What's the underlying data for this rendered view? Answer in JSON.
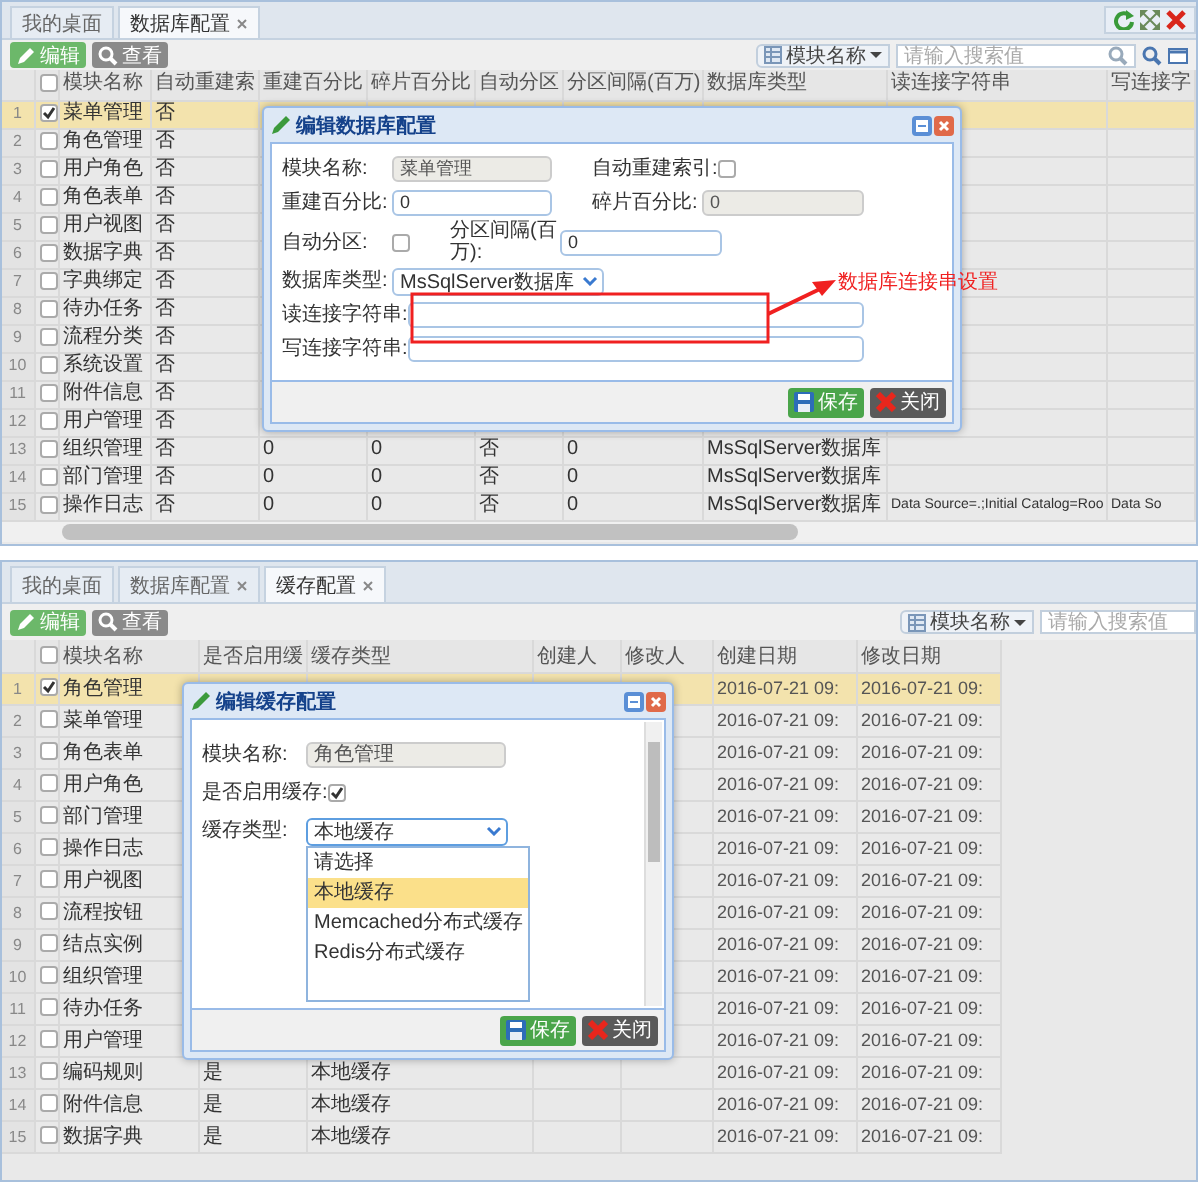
{
  "panels": [
    {
      "tabs": [
        {
          "label": "我的桌面",
          "closable": false,
          "selected": false
        },
        {
          "label": "数据库配置",
          "closable": true,
          "selected": true
        }
      ],
      "toolbar": {
        "buttons": [
          {
            "label": "编辑",
            "kind": "edit"
          },
          {
            "label": "查看",
            "kind": "view"
          }
        ],
        "search": {
          "field": "模块名称",
          "placeholder": "请输入搜索值"
        }
      },
      "table": {
        "all_checked": false,
        "h_scroll": true,
        "columns": [
          "模块名称",
          "自动重建索",
          "重建百分比",
          "碎片百分比",
          "自动分区",
          "分区间隔(百万)",
          "数据库类型",
          "读连接字符串",
          "写连接字"
        ],
        "rows": [
          {
            "no": "1",
            "checked": true,
            "selected": true,
            "cells": [
              "菜单管理",
              "否",
              null,
              null,
              null,
              null,
              null,
              null,
              null
            ]
          },
          {
            "no": "2",
            "checked": false,
            "selected": false,
            "cells": [
              "角色管理",
              "否",
              null,
              null,
              null,
              null,
              null,
              null,
              null
            ]
          },
          {
            "no": "3",
            "checked": false,
            "selected": false,
            "cells": [
              "用户角色",
              "否",
              null,
              null,
              null,
              null,
              null,
              null,
              null
            ]
          },
          {
            "no": "4",
            "checked": false,
            "selected": false,
            "cells": [
              "角色表单",
              "否",
              null,
              null,
              null,
              null,
              null,
              null,
              null
            ]
          },
          {
            "no": "5",
            "checked": false,
            "selected": false,
            "cells": [
              "用户视图",
              "否",
              null,
              null,
              null,
              null,
              null,
              null,
              null
            ]
          },
          {
            "no": "6",
            "checked": false,
            "selected": false,
            "cells": [
              "数据字典",
              "否",
              null,
              null,
              null,
              null,
              null,
              null,
              null
            ]
          },
          {
            "no": "7",
            "checked": false,
            "selected": false,
            "cells": [
              "字典绑定",
              "否",
              null,
              null,
              null,
              null,
              null,
              null,
              null
            ]
          },
          {
            "no": "8",
            "checked": false,
            "selected": false,
            "cells": [
              "待办任务",
              "否",
              null,
              null,
              null,
              null,
              null,
              null,
              null
            ]
          },
          {
            "no": "9",
            "checked": false,
            "selected": false,
            "cells": [
              "流程分类",
              "否",
              null,
              null,
              null,
              null,
              null,
              null,
              null
            ]
          },
          {
            "no": "10",
            "checked": false,
            "selected": false,
            "cells": [
              "系统设置",
              "否",
              null,
              null,
              null,
              null,
              null,
              null,
              null
            ]
          },
          {
            "no": "11",
            "checked": false,
            "selected": false,
            "cells": [
              "附件信息",
              "否",
              null,
              null,
              null,
              null,
              null,
              null,
              null
            ]
          },
          {
            "no": "12",
            "checked": false,
            "selected": false,
            "cells": [
              "用户管理",
              "否",
              null,
              null,
              null,
              null,
              null,
              null,
              null
            ]
          },
          {
            "no": "13",
            "checked": false,
            "selected": false,
            "cells": [
              "组织管理",
              "否",
              "0",
              "0",
              "否",
              "0",
              "MsSqlServer数据库",
              null,
              null
            ]
          },
          {
            "no": "14",
            "checked": false,
            "selected": false,
            "cells": [
              "部门管理",
              "否",
              "0",
              "0",
              "否",
              "0",
              "MsSqlServer数据库",
              null,
              null
            ]
          },
          {
            "no": "15",
            "checked": false,
            "selected": false,
            "cells": [
              "操作日志",
              "否",
              "0",
              "0",
              "否",
              "0",
              "MsSqlServer数据库",
              "Data Source=.;Initial Catalog=Roo",
              "Data So"
            ]
          }
        ]
      },
      "dialog": {
        "title": "编辑数据库配置",
        "lines": [
          [
            {
              "kind": "text",
              "label": "模块名称:",
              "value": "菜单管理",
              "disabled": true
            },
            {
              "kind": "checkbox",
              "label": "自动重建索引:",
              "checked": false
            }
          ],
          [
            {
              "kind": "text",
              "label": "重建百分比:",
              "value": "0",
              "disabled": false
            },
            {
              "kind": "text",
              "label": "碎片百分比:",
              "value": "0",
              "disabled": true
            }
          ],
          [
            {
              "kind": "checkbox",
              "label": "自动分区:",
              "checked": false
            },
            {
              "kind": "text",
              "label": "分区间隔(百万):",
              "value": "0",
              "disabled": false
            }
          ],
          [
            {
              "kind": "select",
              "label": "数据库类型:",
              "value": "MsSqlServer数据库",
              "open": false
            }
          ],
          [
            {
              "kind": "text",
              "label": "读连接字符串:",
              "disabled": false
            }
          ],
          [
            {
              "kind": "text",
              "label": "写连接字符串:",
              "disabled": false
            }
          ]
        ],
        "buttons": [
          {
            "label": "保存",
            "kind": "save"
          },
          {
            "label": "关闭",
            "kind": "close"
          }
        ]
      },
      "annotation": {
        "text": "数据库连接串设置"
      }
    },
    {
      "tabs": [
        {
          "label": "我的桌面",
          "closable": false,
          "selected": false
        },
        {
          "label": "数据库配置",
          "closable": true,
          "selected": false
        },
        {
          "label": "缓存配置",
          "closable": true,
          "selected": true
        }
      ],
      "toolbar": {
        "buttons": [
          {
            "label": "编辑",
            "kind": "edit"
          },
          {
            "label": "查看",
            "kind": "view"
          }
        ],
        "search": {
          "field": "模块名称",
          "placeholder": "请输入搜索值"
        }
      },
      "table": {
        "all_checked": false,
        "columns": [
          "模块名称",
          "是否启用缓",
          "缓存类型",
          "创建人",
          "修改人",
          "创建日期",
          "修改日期"
        ],
        "rows": [
          {
            "no": "1",
            "checked": true,
            "selected": true,
            "cells": [
              "角色管理",
              null,
              null,
              null,
              null,
              "2016-07-21 09:",
              "2016-07-21 09:"
            ]
          },
          {
            "no": "2",
            "checked": false,
            "selected": false,
            "cells": [
              "菜单管理",
              null,
              null,
              null,
              null,
              "2016-07-21 09:",
              "2016-07-21 09:"
            ]
          },
          {
            "no": "3",
            "checked": false,
            "selected": false,
            "cells": [
              "角色表单",
              null,
              null,
              null,
              null,
              "2016-07-21 09:",
              "2016-07-21 09:"
            ]
          },
          {
            "no": "4",
            "checked": false,
            "selected": false,
            "cells": [
              "用户角色",
              null,
              null,
              null,
              null,
              "2016-07-21 09:",
              "2016-07-21 09:"
            ]
          },
          {
            "no": "5",
            "checked": false,
            "selected": false,
            "cells": [
              "部门管理",
              null,
              null,
              null,
              null,
              "2016-07-21 09:",
              "2016-07-21 09:"
            ]
          },
          {
            "no": "6",
            "checked": false,
            "selected": false,
            "cells": [
              "操作日志",
              null,
              null,
              null,
              null,
              "2016-07-21 09:",
              "2016-07-21 09:"
            ]
          },
          {
            "no": "7",
            "checked": false,
            "selected": false,
            "cells": [
              "用户视图",
              null,
              null,
              null,
              null,
              "2016-07-21 09:",
              "2016-07-21 09:"
            ]
          },
          {
            "no": "8",
            "checked": false,
            "selected": false,
            "cells": [
              "流程按钮",
              null,
              null,
              null,
              null,
              "2016-07-21 09:",
              "2016-07-21 09:"
            ]
          },
          {
            "no": "9",
            "checked": false,
            "selected": false,
            "cells": [
              "结点实例",
              null,
              null,
              null,
              null,
              "2016-07-21 09:",
              "2016-07-21 09:"
            ]
          },
          {
            "no": "10",
            "checked": false,
            "selected": false,
            "cells": [
              "组织管理",
              null,
              null,
              null,
              null,
              "2016-07-21 09:",
              "2016-07-21 09:"
            ]
          },
          {
            "no": "11",
            "checked": false,
            "selected": false,
            "cells": [
              "待办任务",
              null,
              null,
              null,
              null,
              "2016-07-21 09:",
              "2016-07-21 09:"
            ]
          },
          {
            "no": "12",
            "checked": false,
            "selected": false,
            "cells": [
              "用户管理",
              null,
              null,
              null,
              null,
              "2016-07-21 09:",
              "2016-07-21 09:"
            ]
          },
          {
            "no": "13",
            "checked": false,
            "selected": false,
            "cells": [
              "编码规则",
              "是",
              "本地缓存",
              null,
              null,
              "2016-07-21 09:",
              "2016-07-21 09:"
            ]
          },
          {
            "no": "14",
            "checked": false,
            "selected": false,
            "cells": [
              "附件信息",
              "是",
              "本地缓存",
              null,
              null,
              "2016-07-21 09:",
              "2016-07-21 09:"
            ]
          },
          {
            "no": "15",
            "checked": false,
            "selected": false,
            "cells": [
              "数据字典",
              "是",
              "本地缓存",
              null,
              null,
              "2016-07-21 09:",
              "2016-07-21 09:"
            ]
          }
        ]
      },
      "dialog": {
        "title": "编辑缓存配置",
        "scrollable": true,
        "lines": [
          [
            {
              "kind": "text",
              "label": "模块名称:",
              "value": "角色管理",
              "disabled": true
            }
          ],
          [
            {
              "kind": "checkbox",
              "label": "是否启用缓存:",
              "checked": true
            }
          ],
          [
            {
              "kind": "select",
              "label": "缓存类型:",
              "value": "本地缓存",
              "open": true,
              "options": [
                {
                  "label": "请选择",
                  "selected": false
                },
                {
                  "label": "本地缓存",
                  "selected": true
                },
                {
                  "label": "Memcached分布式缓存",
                  "selected": false
                },
                {
                  "label": "Redis分布式缓存",
                  "selected": false
                }
              ]
            }
          ]
        ],
        "buttons": [
          {
            "label": "保存",
            "kind": "save"
          },
          {
            "label": "关闭",
            "kind": "close"
          }
        ]
      }
    }
  ]
}
